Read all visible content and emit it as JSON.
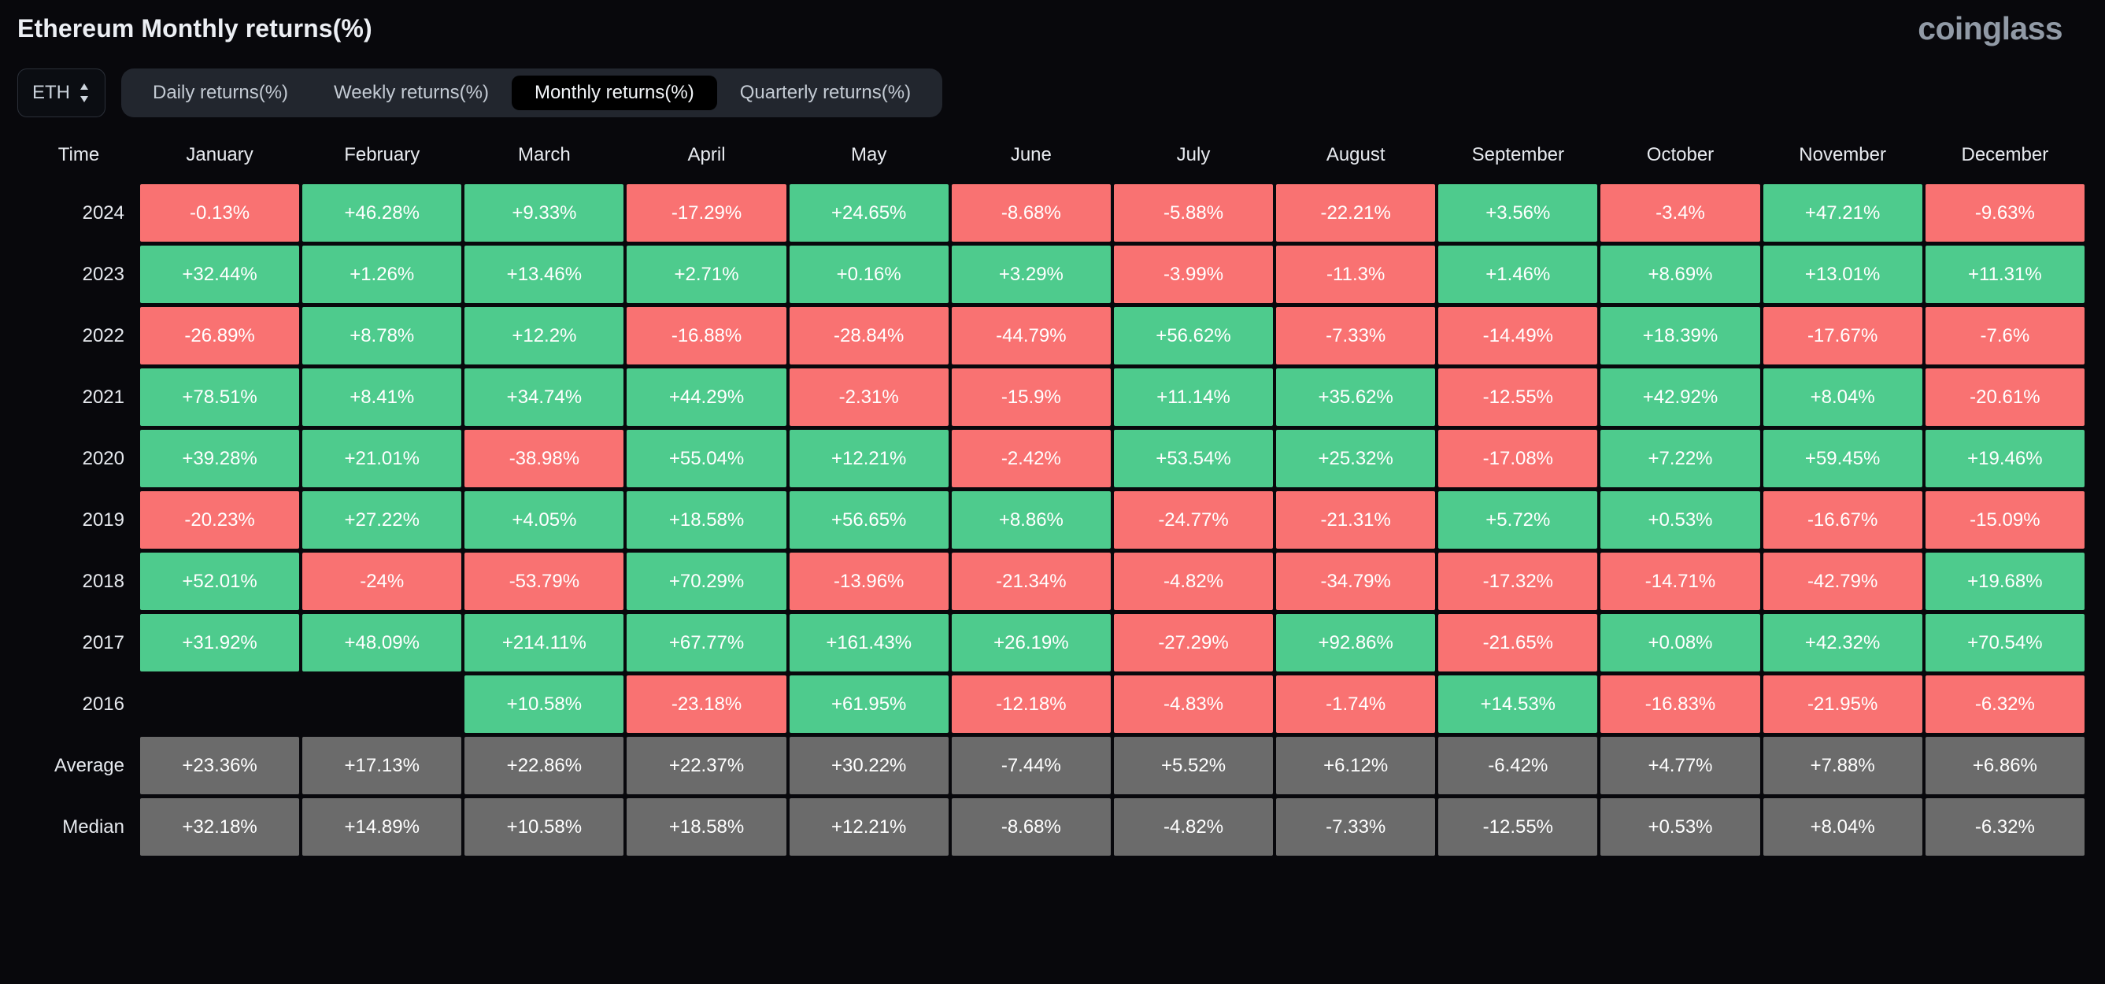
{
  "header": {
    "title": "Ethereum Monthly returns(%)",
    "brand": "coinglass"
  },
  "controls": {
    "asset": "ETH",
    "tabs": [
      {
        "label": "Daily returns(%)",
        "active": false
      },
      {
        "label": "Weekly returns(%)",
        "active": false
      },
      {
        "label": "Monthly returns(%)",
        "active": true
      },
      {
        "label": "Quarterly returns(%)",
        "active": false
      }
    ]
  },
  "colors": {
    "positive": "#4ecb8d",
    "negative": "#f97272",
    "summary": "#6b6b6b",
    "background": "#08080c",
    "brand": "#919aa6"
  },
  "chart_data": {
    "type": "heatmap",
    "title": "Ethereum Monthly returns(%)",
    "xlabel": "",
    "ylabel": "Time",
    "columns": [
      "Time",
      "January",
      "February",
      "March",
      "April",
      "May",
      "June",
      "July",
      "August",
      "September",
      "October",
      "November",
      "December"
    ],
    "categories": [
      "January",
      "February",
      "March",
      "April",
      "May",
      "June",
      "July",
      "August",
      "September",
      "October",
      "November",
      "December"
    ],
    "rows": [
      {
        "label": "2024",
        "type": "year",
        "values": [
          "-0.13%",
          "+46.28%",
          "+9.33%",
          "-17.29%",
          "+24.65%",
          "-8.68%",
          "-5.88%",
          "-22.21%",
          "+3.56%",
          "-3.4%",
          "+47.21%",
          "-9.63%"
        ],
        "numeric": [
          -0.13,
          46.28,
          9.33,
          -17.29,
          24.65,
          -8.68,
          -5.88,
          -22.21,
          3.56,
          -3.4,
          47.21,
          -9.63
        ]
      },
      {
        "label": "2023",
        "type": "year",
        "values": [
          "+32.44%",
          "+1.26%",
          "+13.46%",
          "+2.71%",
          "+0.16%",
          "+3.29%",
          "-3.99%",
          "-11.3%",
          "+1.46%",
          "+8.69%",
          "+13.01%",
          "+11.31%"
        ],
        "numeric": [
          32.44,
          1.26,
          13.46,
          2.71,
          0.16,
          3.29,
          -3.99,
          -11.3,
          1.46,
          8.69,
          13.01,
          11.31
        ]
      },
      {
        "label": "2022",
        "type": "year",
        "values": [
          "-26.89%",
          "+8.78%",
          "+12.2%",
          "-16.88%",
          "-28.84%",
          "-44.79%",
          "+56.62%",
          "-7.33%",
          "-14.49%",
          "+18.39%",
          "-17.67%",
          "-7.6%"
        ],
        "numeric": [
          -26.89,
          8.78,
          12.2,
          -16.88,
          -28.84,
          -44.79,
          56.62,
          -7.33,
          -14.49,
          18.39,
          -17.67,
          -7.6
        ]
      },
      {
        "label": "2021",
        "type": "year",
        "values": [
          "+78.51%",
          "+8.41%",
          "+34.74%",
          "+44.29%",
          "-2.31%",
          "-15.9%",
          "+11.14%",
          "+35.62%",
          "-12.55%",
          "+42.92%",
          "+8.04%",
          "-20.61%"
        ],
        "numeric": [
          78.51,
          8.41,
          34.74,
          44.29,
          -2.31,
          -15.9,
          11.14,
          35.62,
          -12.55,
          42.92,
          8.04,
          -20.61
        ]
      },
      {
        "label": "2020",
        "type": "year",
        "values": [
          "+39.28%",
          "+21.01%",
          "-38.98%",
          "+55.04%",
          "+12.21%",
          "-2.42%",
          "+53.54%",
          "+25.32%",
          "-17.08%",
          "+7.22%",
          "+59.45%",
          "+19.46%"
        ],
        "numeric": [
          39.28,
          21.01,
          -38.98,
          55.04,
          12.21,
          -2.42,
          53.54,
          25.32,
          -17.08,
          7.22,
          59.45,
          19.46
        ]
      },
      {
        "label": "2019",
        "type": "year",
        "values": [
          "-20.23%",
          "+27.22%",
          "+4.05%",
          "+18.58%",
          "+56.65%",
          "+8.86%",
          "-24.77%",
          "-21.31%",
          "+5.72%",
          "+0.53%",
          "-16.67%",
          "-15.09%"
        ],
        "numeric": [
          -20.23,
          27.22,
          4.05,
          18.58,
          56.65,
          8.86,
          -24.77,
          -21.31,
          5.72,
          0.53,
          -16.67,
          -15.09
        ]
      },
      {
        "label": "2018",
        "type": "year",
        "values": [
          "+52.01%",
          "-24%",
          "-53.79%",
          "+70.29%",
          "-13.96%",
          "-21.34%",
          "-4.82%",
          "-34.79%",
          "-17.32%",
          "-14.71%",
          "-42.79%",
          "+19.68%"
        ],
        "numeric": [
          52.01,
          -24,
          -53.79,
          70.29,
          -13.96,
          -21.34,
          -4.82,
          -34.79,
          -17.32,
          -14.71,
          -42.79,
          19.68
        ]
      },
      {
        "label": "2017",
        "type": "year",
        "values": [
          "+31.92%",
          "+48.09%",
          "+214.11%",
          "+67.77%",
          "+161.43%",
          "+26.19%",
          "-27.29%",
          "+92.86%",
          "-21.65%",
          "+0.08%",
          "+42.32%",
          "+70.54%"
        ],
        "numeric": [
          31.92,
          48.09,
          214.11,
          67.77,
          161.43,
          26.19,
          -27.29,
          92.86,
          -21.65,
          0.08,
          42.32,
          70.54
        ]
      },
      {
        "label": "2016",
        "type": "year",
        "values": [
          "",
          "",
          "+10.58%",
          "-23.18%",
          "+61.95%",
          "-12.18%",
          "-4.83%",
          "-1.74%",
          "+14.53%",
          "-16.83%",
          "-21.95%",
          "-6.32%"
        ],
        "numeric": [
          null,
          null,
          10.58,
          -23.18,
          61.95,
          -12.18,
          -4.83,
          -1.74,
          14.53,
          -16.83,
          -21.95,
          -6.32
        ]
      },
      {
        "label": "Average",
        "type": "summary",
        "values": [
          "+23.36%",
          "+17.13%",
          "+22.86%",
          "+22.37%",
          "+30.22%",
          "-7.44%",
          "+5.52%",
          "+6.12%",
          "-6.42%",
          "+4.77%",
          "+7.88%",
          "+6.86%"
        ],
        "numeric": [
          23.36,
          17.13,
          22.86,
          22.37,
          30.22,
          -7.44,
          5.52,
          6.12,
          -6.42,
          4.77,
          7.88,
          6.86
        ]
      },
      {
        "label": "Median",
        "type": "summary",
        "values": [
          "+32.18%",
          "+14.89%",
          "+10.58%",
          "+18.58%",
          "+12.21%",
          "-8.68%",
          "-4.82%",
          "-7.33%",
          "-12.55%",
          "+0.53%",
          "+8.04%",
          "-6.32%"
        ],
        "numeric": [
          32.18,
          14.89,
          10.58,
          18.58,
          12.21,
          -8.68,
          -4.82,
          -7.33,
          -12.55,
          0.53,
          8.04,
          -6.32
        ]
      }
    ]
  }
}
